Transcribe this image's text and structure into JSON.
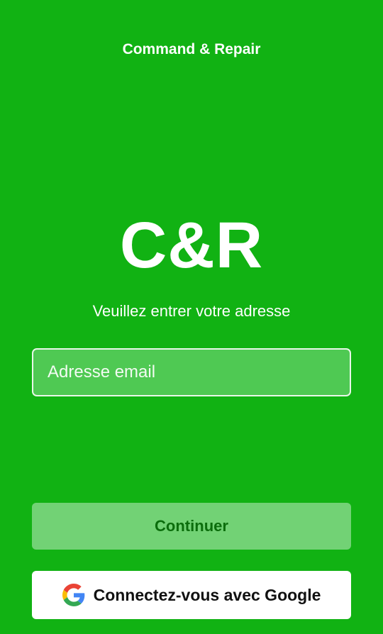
{
  "app": {
    "title": "Command & Repair",
    "logo_text": "C&R",
    "subtitle": "Veuillez entrer votre adresse"
  },
  "email": {
    "placeholder": "Adresse email",
    "value": ""
  },
  "buttons": {
    "continue_label": "Continuer",
    "google_label": "Connectez-vous avec Google"
  },
  "icons": {
    "google": "google-icon"
  },
  "colors": {
    "background": "#11b213",
    "input_fill": "#4fc953",
    "continue_fill": "#72d275",
    "continue_text": "#0b6d0c",
    "google_button": "#ffffff"
  }
}
